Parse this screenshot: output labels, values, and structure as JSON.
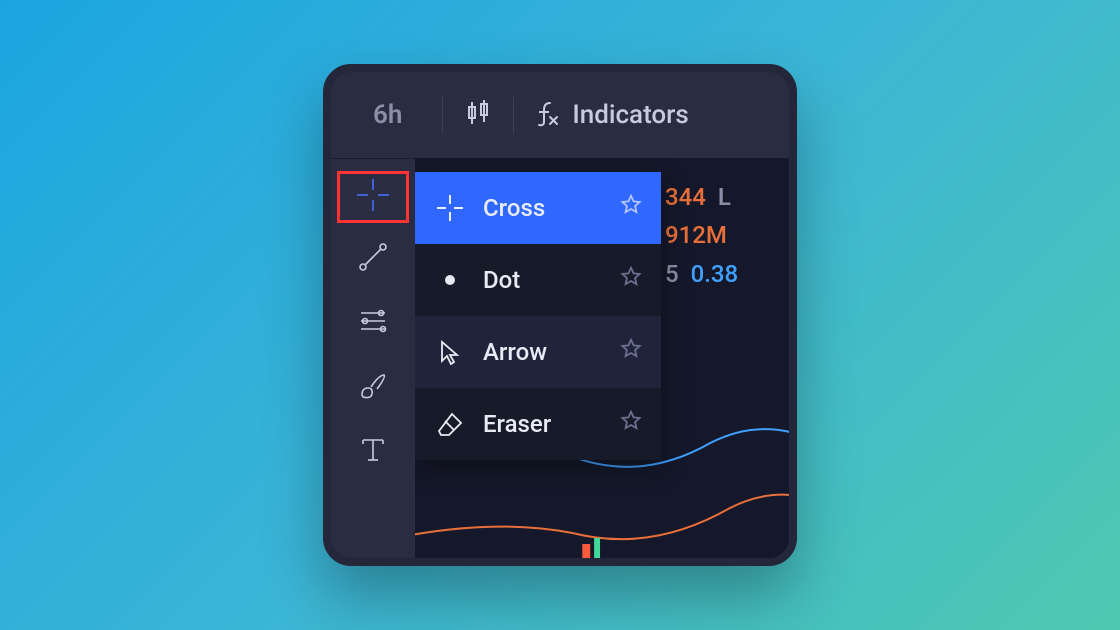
{
  "topbar": {
    "timeframe": "6h",
    "indicators_label": "Indicators"
  },
  "cursor_menu": {
    "items": [
      {
        "label": "Cross",
        "selected": true
      },
      {
        "label": "Dot",
        "selected": false
      },
      {
        "label": "Arrow",
        "selected": false,
        "hover": true
      },
      {
        "label": "Eraser",
        "selected": false
      }
    ]
  },
  "bg_readout": {
    "val1": "344",
    "label1": "L",
    "val2": "912M",
    "label3_prefix": "5",
    "val3": "0.38"
  },
  "side_tools": [
    "crosshair",
    "trend-line",
    "fib-lines",
    "brush",
    "text"
  ]
}
